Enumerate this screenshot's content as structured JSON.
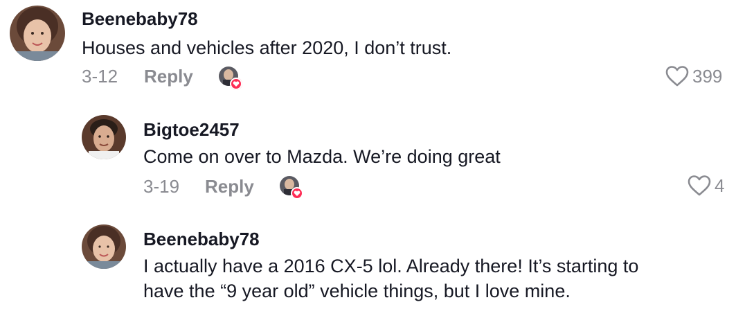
{
  "comments": [
    {
      "username": "Beenebaby78",
      "text": "Houses and vehicles after 2020, I don’t trust.",
      "date": "3-12",
      "reply_label": "Reply",
      "likes": "399"
    },
    {
      "username": "Bigtoe2457",
      "text": "Come on over to Mazda. We’re doing great",
      "date": "3-19",
      "reply_label": "Reply",
      "likes": "4"
    },
    {
      "username": "Beenebaby78",
      "text_line1": "I actually have a 2016 CX-5 lol. Already there! It’s starting to",
      "text_line2": "have the “9 year old” vehicle things, but I love mine."
    }
  ],
  "colors": {
    "text": "#161823",
    "secondary": "#8a8b91",
    "badge_heart": "#fe2c55"
  },
  "icons": {
    "like": "heart-outline-icon",
    "creator_liked": "creator-liked-badge-icon"
  }
}
